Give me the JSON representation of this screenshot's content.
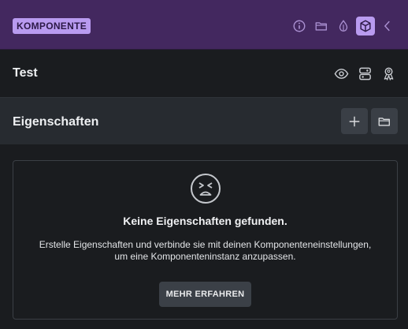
{
  "header": {
    "badge": "KOMPONENTE",
    "icons": [
      "info-icon",
      "folder-icon",
      "drop-icon",
      "cube-icon",
      "chevron-left-icon"
    ],
    "accent": "#43285f",
    "badge_color": "#b99bf0"
  },
  "component": {
    "name": "Test",
    "icons": [
      "eye-icon",
      "layout-toggle-icon",
      "badge-person-icon"
    ]
  },
  "properties": {
    "title": "Eigenschaften",
    "icons": [
      "plus-icon",
      "folder-icon"
    ]
  },
  "empty_state": {
    "icon": "frown-face-icon",
    "title": "Keine Eigenschaften gefunden.",
    "description_line1": "Erstelle Eigenschaften und verbinde sie mit deinen Komponenteneinstellungen,",
    "description_line2": "um eine Komponenteninstanz anzupassen.",
    "button_label": "MEHR ERFAHREN"
  }
}
